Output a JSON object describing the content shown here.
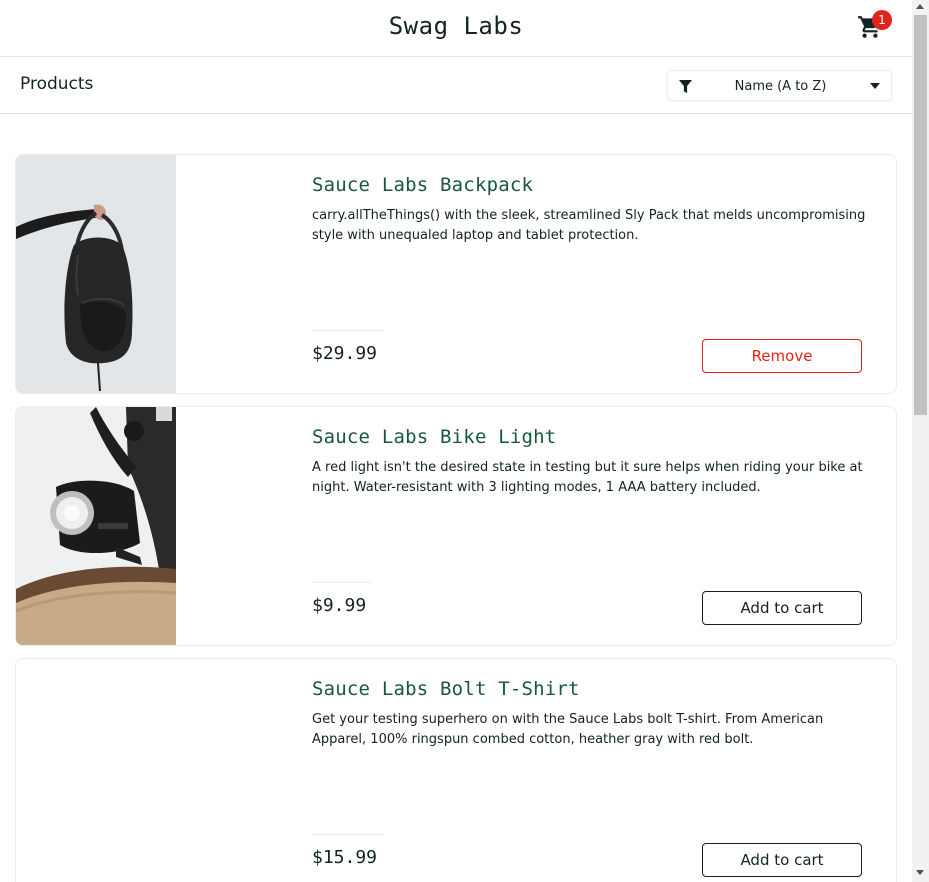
{
  "header": {
    "app_title": "Swag Labs",
    "cart_count": "1",
    "cart_icon": "shopping-cart-icon"
  },
  "subheader": {
    "title": "Products",
    "sort": {
      "selected": "Name (A to Z)",
      "icon": "filter-icon"
    }
  },
  "products": [
    {
      "name": "Sauce Labs Backpack",
      "description": "carry.allTheThings() with the sleek, streamlined Sly Pack that melds uncompromising style with unequaled laptop and tablet protection.",
      "price": "$29.99",
      "button": "Remove",
      "image": "backpack-photo"
    },
    {
      "name": "Sauce Labs Bike Light",
      "description": "A red light isn't the desired state in testing but it sure helps when riding your bike at night. Water-resistant with 3 lighting modes, 1 AAA battery included.",
      "price": "$9.99",
      "button": "Add to cart",
      "image": "bike-light-photo"
    },
    {
      "name": "Sauce Labs Bolt T-Shirt",
      "description": "Get your testing superhero on with the Sauce Labs bolt T-shirt. From American Apparel, 100% ringspun combed cotton, heather gray with red bolt.",
      "price": "$15.99",
      "button": "Add to cart",
      "image": "bolt-tshirt-photo"
    }
  ],
  "colors": {
    "accent_green": "#18583a",
    "remove_red": "#e2231a",
    "badge_red": "#e2231a",
    "text": "#132322"
  }
}
